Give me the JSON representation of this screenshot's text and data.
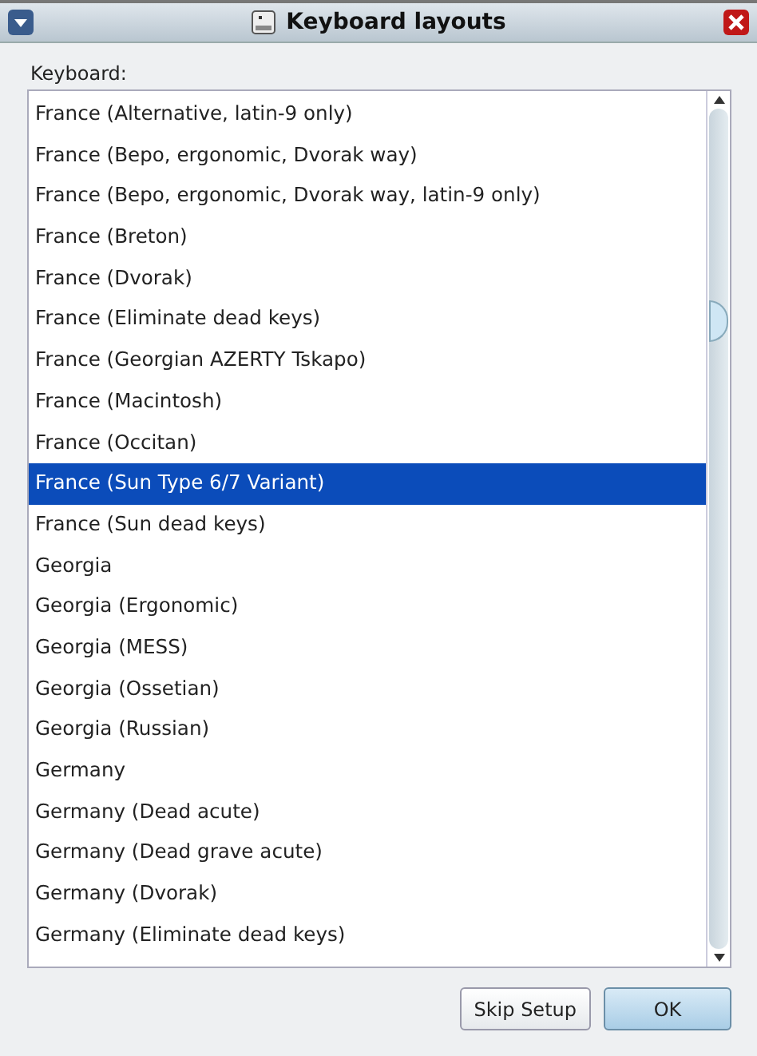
{
  "window": {
    "title": "Keyboard layouts"
  },
  "keyboard_label": "Keyboard:",
  "layouts": [
    {
      "label": "France (Alternative, latin-9 only)",
      "selected": false
    },
    {
      "label": "France (Bepo, ergonomic, Dvorak way)",
      "selected": false
    },
    {
      "label": "France (Bepo, ergonomic, Dvorak way, latin-9 only)",
      "selected": false
    },
    {
      "label": "France (Breton)",
      "selected": false
    },
    {
      "label": "France (Dvorak)",
      "selected": false
    },
    {
      "label": "France (Eliminate dead keys)",
      "selected": false
    },
    {
      "label": "France (Georgian AZERTY Tskapo)",
      "selected": false
    },
    {
      "label": "France (Macintosh)",
      "selected": false
    },
    {
      "label": "France (Occitan)",
      "selected": false
    },
    {
      "label": "France (Sun Type 6/7 Variant)",
      "selected": true
    },
    {
      "label": "France (Sun dead keys)",
      "selected": false
    },
    {
      "label": "Georgia",
      "selected": false
    },
    {
      "label": "Georgia (Ergonomic)",
      "selected": false
    },
    {
      "label": "Georgia (MESS)",
      "selected": false
    },
    {
      "label": "Georgia (Ossetian)",
      "selected": false
    },
    {
      "label": "Georgia (Russian)",
      "selected": false
    },
    {
      "label": "Germany",
      "selected": false
    },
    {
      "label": "Germany (Dead acute)",
      "selected": false
    },
    {
      "label": "Germany (Dead grave acute)",
      "selected": false
    },
    {
      "label": "Germany (Dvorak)",
      "selected": false
    },
    {
      "label": "Germany (Eliminate dead keys)",
      "selected": false
    }
  ],
  "buttons": [
    "Skip Setup",
    "OK"
  ]
}
